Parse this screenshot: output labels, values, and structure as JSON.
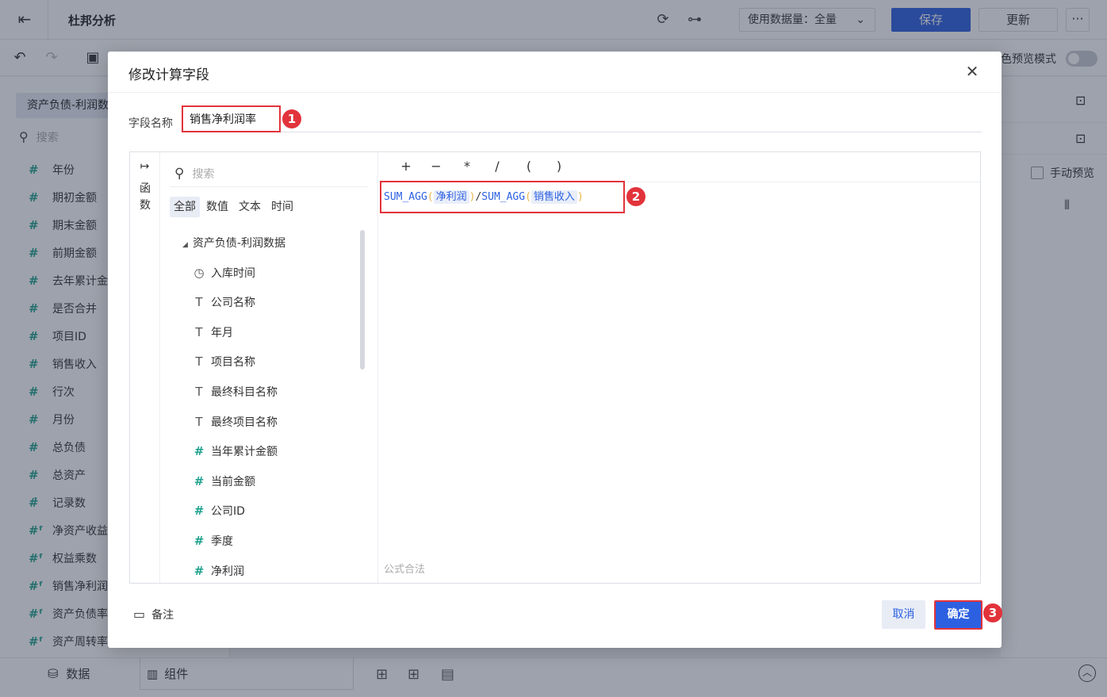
{
  "app": {
    "title": "杜邦分析",
    "data_amount_label": "使用数据量：全量",
    "save_label": "保存",
    "update_label": "更新",
    "more_label": "···",
    "preview_mode_label": "色预览模式",
    "preview_mode_on": false
  },
  "left_panel": {
    "dataset_tab": "资产负债-利润数",
    "search_placeholder": "搜索",
    "fields": [
      {
        "icon": "number-icon",
        "label": "年份"
      },
      {
        "icon": "number-icon",
        "label": "期初金额"
      },
      {
        "icon": "number-icon",
        "label": "期末金额"
      },
      {
        "icon": "number-icon",
        "label": "前期金额"
      },
      {
        "icon": "number-icon",
        "label": "去年累计金"
      },
      {
        "icon": "number-icon",
        "label": "是否合并"
      },
      {
        "icon": "number-icon",
        "label": "项目ID"
      },
      {
        "icon": "number-icon",
        "label": "销售收入"
      },
      {
        "icon": "number-icon",
        "label": "行次"
      },
      {
        "icon": "number-icon",
        "label": "月份"
      },
      {
        "icon": "number-icon",
        "label": "总负债"
      },
      {
        "icon": "number-icon",
        "label": "总资产"
      },
      {
        "icon": "record-count-icon",
        "label": "记录数"
      },
      {
        "icon": "calc-field-icon",
        "label": "净资产收益"
      },
      {
        "icon": "calc-field-icon",
        "label": "权益乘数"
      },
      {
        "icon": "calc-field-icon",
        "label": "销售净利润"
      },
      {
        "icon": "calc-field-icon",
        "label": "资产负债率"
      },
      {
        "icon": "calc-field-icon",
        "label": "资产周转率"
      }
    ]
  },
  "right_area": {
    "manual_preview_label": "手动预览"
  },
  "bottom": {
    "data_tab": "数据",
    "component_tab": "组件"
  },
  "modal": {
    "title": "修改计算字段",
    "field_name_label": "字段名称",
    "field_name_value": "销售净利润率",
    "function_toggle_label": "函数",
    "search_placeholder": "搜索",
    "type_tabs": [
      "全部",
      "数值",
      "文本",
      "时间"
    ],
    "active_type_tab": "全部",
    "tree_root": "资产负债-利润数据",
    "tree_fields": [
      {
        "type": "time",
        "label": "入库时间"
      },
      {
        "type": "text",
        "label": "公司名称"
      },
      {
        "type": "text",
        "label": "年月"
      },
      {
        "type": "text",
        "label": "项目名称"
      },
      {
        "type": "text",
        "label": "最终科目名称"
      },
      {
        "type": "text",
        "label": "最终项目名称"
      },
      {
        "type": "number",
        "label": "当年累计金额"
      },
      {
        "type": "number",
        "label": "当前金额"
      },
      {
        "type": "number",
        "label": "公司ID"
      },
      {
        "type": "number",
        "label": "季度"
      },
      {
        "type": "number",
        "label": "净利润"
      }
    ],
    "operators": [
      "+",
      "−",
      "*",
      "/",
      "(",
      ")"
    ],
    "formula": {
      "fn1": "SUM_AGG",
      "field1": "净利润",
      "divider": "/",
      "fn2": "SUM_AGG",
      "field2": "销售收入",
      "open_paren": "(",
      "close_paren": ")"
    },
    "formula_status": "公式合法",
    "notes_label": "备注",
    "cancel_label": "取消",
    "ok_label": "确定",
    "annotations": [
      "1",
      "2",
      "3"
    ]
  }
}
